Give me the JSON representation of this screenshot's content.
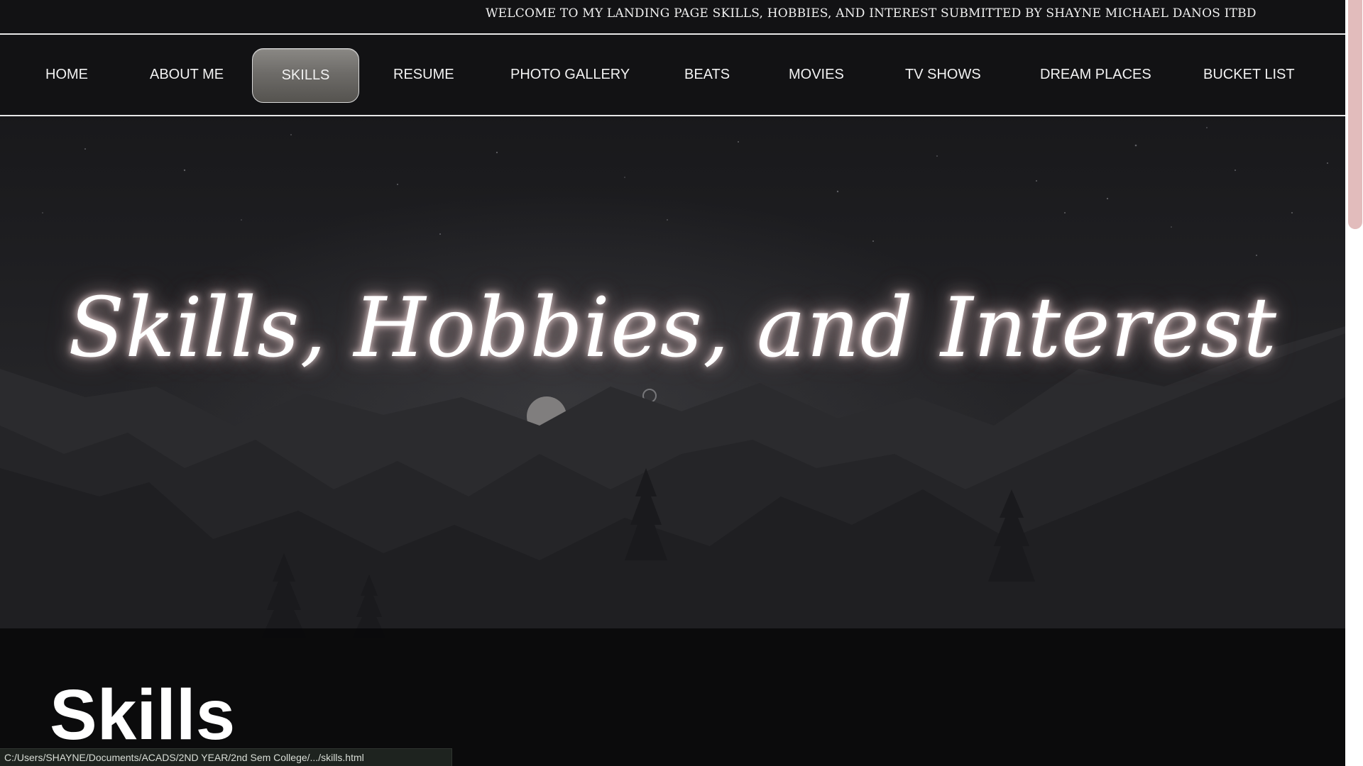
{
  "header": {
    "welcome_text": "WELCOME TO MY LANDING PAGE SKILLS, HOBBIES, AND INTEREST SUBMITTED BY SHAYNE MICHAEL DANOS ITBD"
  },
  "nav": {
    "items": [
      {
        "label": "HOME"
      },
      {
        "label": "ABOUT ME"
      },
      {
        "label": "SKILLS",
        "active": true
      },
      {
        "label": "RESUME"
      },
      {
        "label": "PHOTO GALLERY"
      },
      {
        "label": "BEATS"
      },
      {
        "label": "MOVIES"
      },
      {
        "label": "TV SHOWS"
      },
      {
        "label": "DREAM PLACES"
      },
      {
        "label": "BUCKET LIST"
      }
    ]
  },
  "hero": {
    "title": "Skills, Hobbies, and Interest"
  },
  "section": {
    "heading": "Skills"
  },
  "statusbar": {
    "url": "C:/Users/SHAYNE/Documents/ACADS/2ND YEAR/2nd Sem College/.../skills.html"
  },
  "colors": {
    "nav_background": "#121214",
    "active_tab": "#6e6c69",
    "scroll_thumb": "#e2bcbc",
    "title_glow": "#ffe6e6"
  }
}
